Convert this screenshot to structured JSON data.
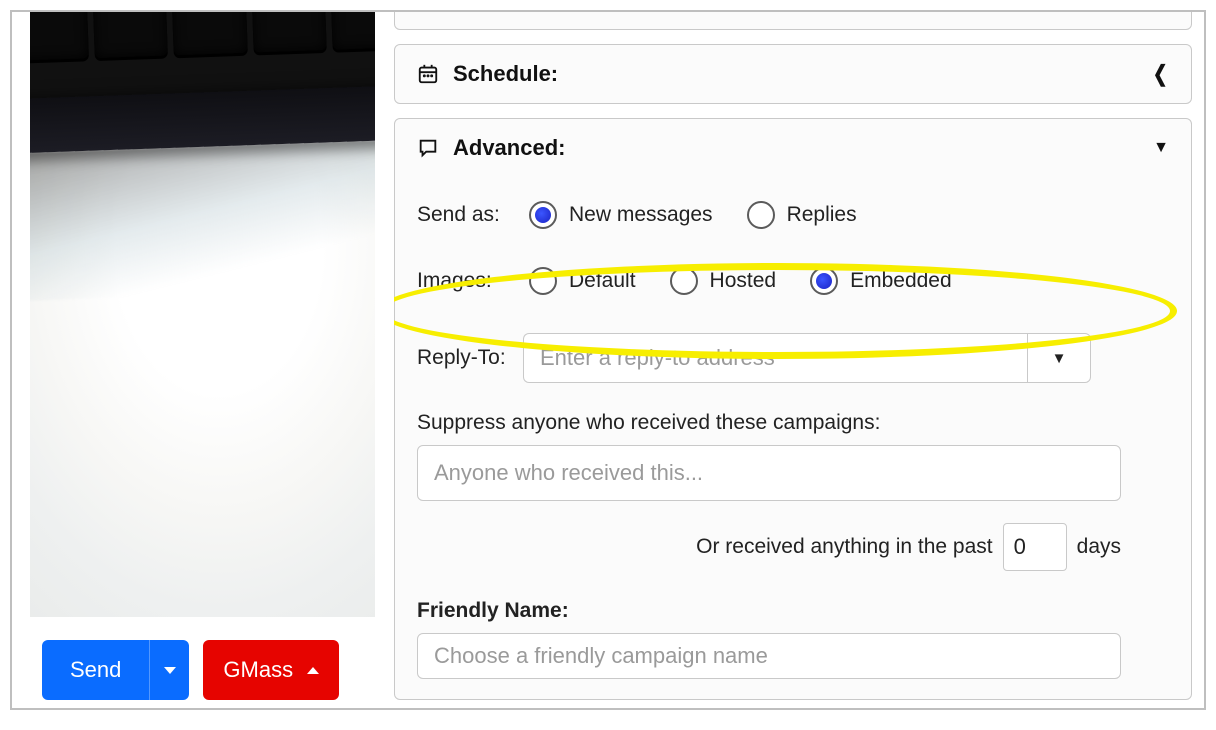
{
  "buttons": {
    "send": "Send",
    "gmass": "GMass"
  },
  "schedule": {
    "title": "Schedule:"
  },
  "advanced": {
    "title": "Advanced:",
    "send_as": {
      "label": "Send as:",
      "options": {
        "new": "New messages",
        "replies": "Replies"
      },
      "selected": "new"
    },
    "images": {
      "label": "Images:",
      "options": {
        "default": "Default",
        "hosted": "Hosted",
        "embedded": "Embedded"
      },
      "selected": "embedded"
    },
    "reply_to": {
      "label": "Reply-To:",
      "placeholder": "Enter a reply-to address"
    },
    "suppress": {
      "label": "Suppress anyone who received these campaigns:",
      "placeholder": "Anyone who received this..."
    },
    "or_received": {
      "prefix": "Or received anything in the past",
      "value": "0",
      "suffix": "days"
    },
    "friendly_name": {
      "label": "Friendly Name:",
      "placeholder": "Choose a friendly campaign name"
    }
  }
}
